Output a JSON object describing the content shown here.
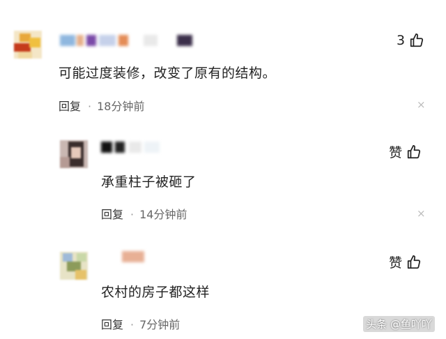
{
  "comments": [
    {
      "text": "可能过度装修，改变了原有的结构。",
      "reply_label": "回复",
      "time": "18分钟前",
      "like_label": "3",
      "like_icon": "thumbs-up-icon",
      "close_icon": "close-icon"
    },
    {
      "text": "承重柱子被砸了",
      "reply_label": "回复",
      "time": "14分钟前",
      "like_label": "赞",
      "like_icon": "thumbs-up-icon",
      "close_icon": "close-icon"
    },
    {
      "text": "农村的房子都这样",
      "reply_label": "回复",
      "time": "7分钟前",
      "like_label": "赞",
      "like_icon": "thumbs-up-icon"
    }
  ],
  "separator": "·",
  "close_glyph": "×",
  "watermark": "头条 @鱼吖吖",
  "colors": {
    "text": "#222222",
    "meta": "#666666",
    "close": "#bbbbbb"
  }
}
